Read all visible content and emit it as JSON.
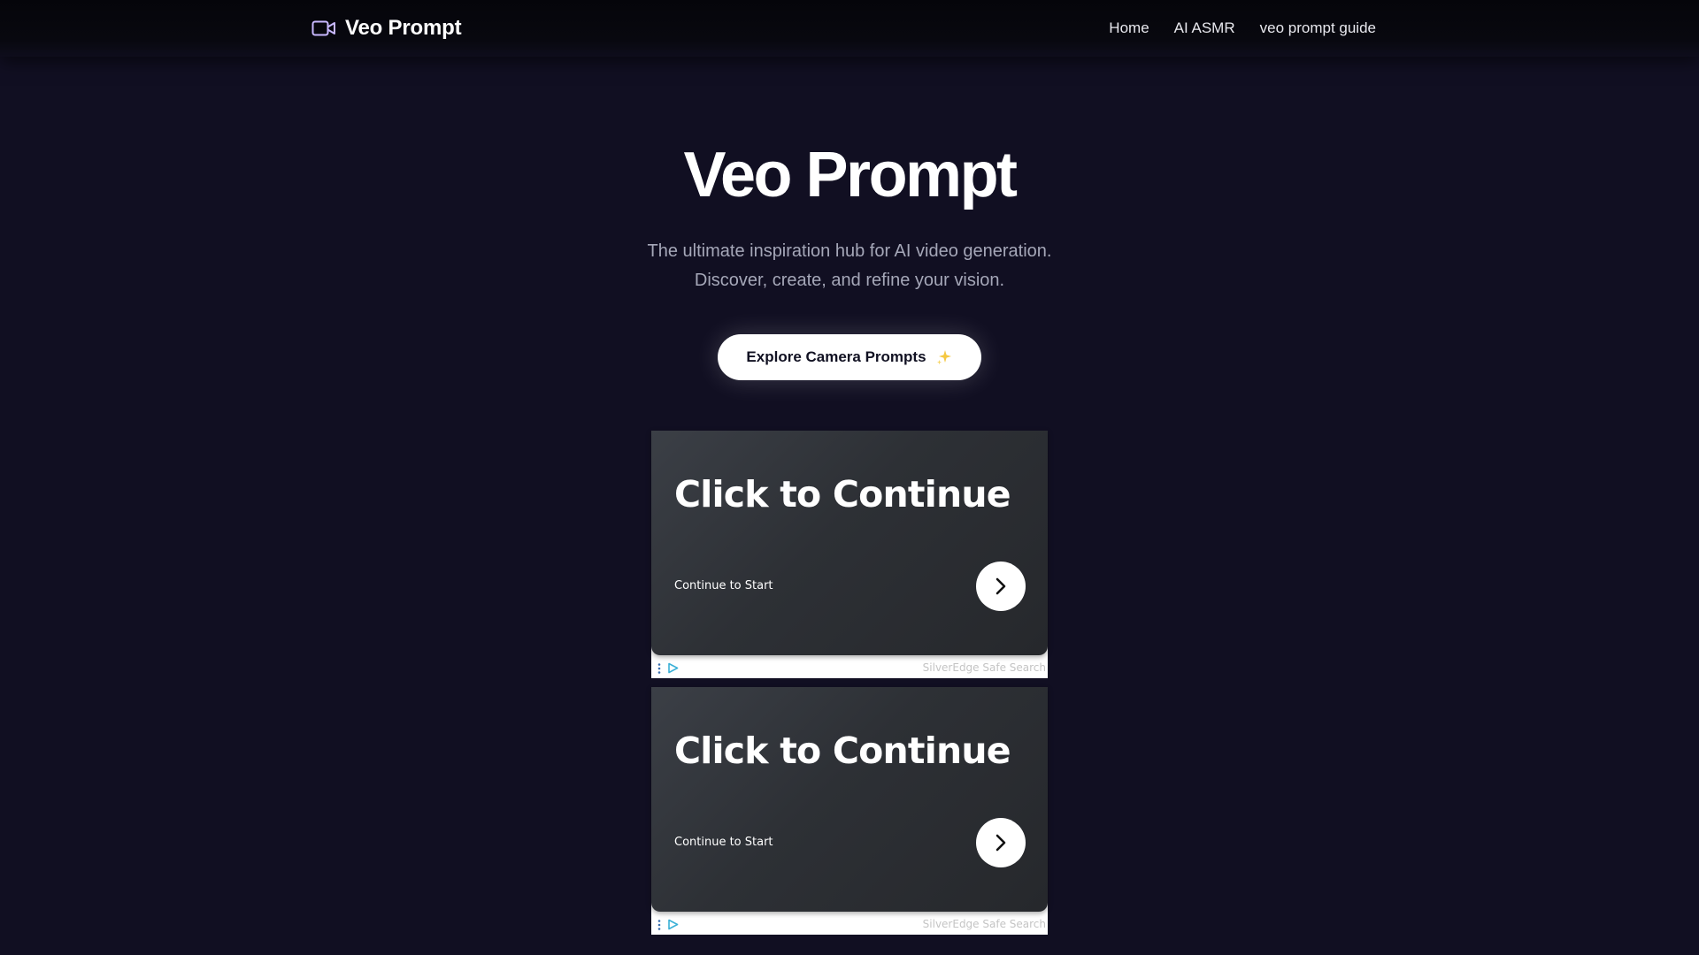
{
  "nav": {
    "brand": "Veo Prompt",
    "links": [
      {
        "label": "Home"
      },
      {
        "label": "AI ASMR"
      },
      {
        "label": "veo prompt guide"
      }
    ]
  },
  "hero": {
    "title": "Veo Prompt",
    "subtitle_line1": "The ultimate inspiration hub for AI video generation.",
    "subtitle_line2": "Discover, create, and refine your vision.",
    "cta_label": "Explore Camera Prompts"
  },
  "ads": [
    {
      "headline": "Click to Continue",
      "subtext": "Continue to Start",
      "sponsor": "SilverEdge Safe Search"
    },
    {
      "headline": "Click to Continue",
      "subtext": "Continue to Start",
      "sponsor": "SilverEdge Safe Search"
    }
  ],
  "icons": {
    "brand": "video-camera-icon",
    "cta": "sparkles-icon",
    "ad_button": "chevron-right-icon",
    "ad_options": "kebab-menu-icon",
    "ad_choices": "ad-choices-icon"
  },
  "colors": {
    "page_background": "#110f22",
    "navbar_background": "#07070d",
    "brand_icon": "#c8b8ff",
    "subtitle_text": "#a5a7b8",
    "cta_background": "#ffffff",
    "sparkle": "#f5c842",
    "ad_card": "#2f3237",
    "ad_choices": "#3ab0d6"
  }
}
